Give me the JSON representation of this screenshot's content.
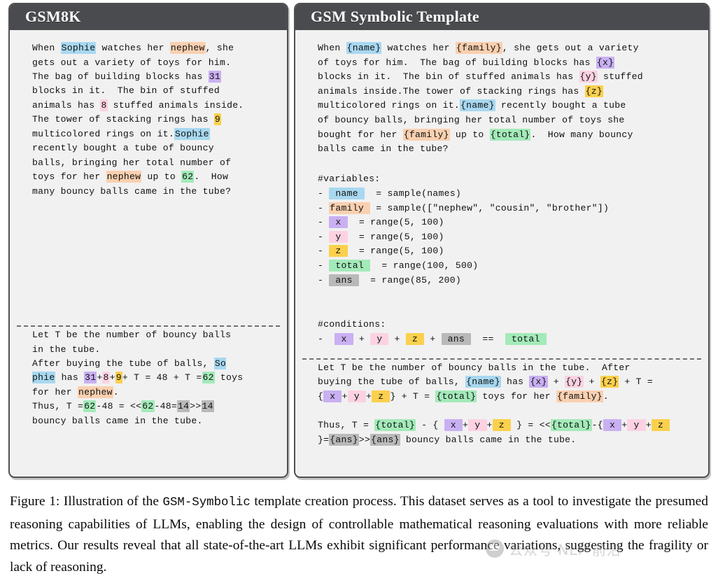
{
  "colors": {
    "page_bg": "#ffffff",
    "panel_bg": "#f1f1f1",
    "panel_border": "#4f5053",
    "header_bg": "#4a4b4e",
    "header_text": "#ffffff",
    "hl_blue": "#a8d8f0",
    "hl_peach": "#fad0b0",
    "hl_purple": "#c9b0f2",
    "hl_pink": "#fcd2e2",
    "hl_yellow": "#fbd04c",
    "hl_green": "#a3eab9",
    "hl_gray": "#b9b9b9"
  },
  "left_panel": {
    "title": "GSM8K",
    "problem_segments": [
      {
        "text": "When ",
        "hl": "none"
      },
      {
        "text": "Sophie",
        "hl": "blue"
      },
      {
        "text": " watches her ",
        "hl": "none"
      },
      {
        "text": "nephew",
        "hl": "peach"
      },
      {
        "text": ", she\ngets out a variety of toys for him.\nThe bag of building blocks has ",
        "hl": "none"
      },
      {
        "text": "31",
        "hl": "purple"
      },
      {
        "text": "\nblocks in it.  The bin of stuffed\nanimals has ",
        "hl": "none"
      },
      {
        "text": "8",
        "hl": "pink"
      },
      {
        "text": " stuffed animals inside.\nThe tower of stacking rings has ",
        "hl": "none"
      },
      {
        "text": "9",
        "hl": "yellow"
      },
      {
        "text": "\nmulticolored rings on it.",
        "hl": "none"
      },
      {
        "text": "Sophie",
        "hl": "blue"
      },
      {
        "text": "\nrecently bought a tube of bouncy\nballs, bringing her total number of\ntoys for her ",
        "hl": "none"
      },
      {
        "text": "nephew",
        "hl": "peach"
      },
      {
        "text": " up to ",
        "hl": "none"
      },
      {
        "text": "62",
        "hl": "green"
      },
      {
        "text": ".  How\nmany bouncy balls came in the tube?",
        "hl": "none"
      }
    ],
    "solution_segments": [
      {
        "text": "Let T be the number of bouncy balls\nin the tube.\nAfter buying the tube of balls, ",
        "hl": "none"
      },
      {
        "text": "So\nphie",
        "hl": "blue"
      },
      {
        "text": " has ",
        "hl": "none"
      },
      {
        "text": "31",
        "hl": "purple"
      },
      {
        "text": "+",
        "hl": "none"
      },
      {
        "text": "8",
        "hl": "pink"
      },
      {
        "text": "+",
        "hl": "none"
      },
      {
        "text": "9",
        "hl": "yellow"
      },
      {
        "text": "+ T = 48 + T =",
        "hl": "none"
      },
      {
        "text": "62",
        "hl": "green"
      },
      {
        "text": " toys\nfor her ",
        "hl": "none"
      },
      {
        "text": "nephew",
        "hl": "peach"
      },
      {
        "text": ".\nThus, T =",
        "hl": "none"
      },
      {
        "text": "62",
        "hl": "green"
      },
      {
        "text": "-48 = <<",
        "hl": "none"
      },
      {
        "text": "62",
        "hl": "green"
      },
      {
        "text": "-48=",
        "hl": "none"
      },
      {
        "text": "14",
        "hl": "gray"
      },
      {
        "text": ">>",
        "hl": "none"
      },
      {
        "text": "14",
        "hl": "gray"
      },
      {
        "text": "\nbouncy balls came in the tube.",
        "hl": "none"
      }
    ]
  },
  "right_panel": {
    "title": "GSM Symbolic Template",
    "template_segments": [
      {
        "text": "When ",
        "hl": "none"
      },
      {
        "text": "{name}",
        "hl": "blue"
      },
      {
        "text": " watches her ",
        "hl": "none"
      },
      {
        "text": "{family}",
        "hl": "peach"
      },
      {
        "text": ", she gets out a variety\nof toys for him.  The bag of building blocks has ",
        "hl": "none"
      },
      {
        "text": "{x}",
        "hl": "purple"
      },
      {
        "text": "\nblocks in it.  The bin of stuffed animals has ",
        "hl": "none"
      },
      {
        "text": "{y}",
        "hl": "pink"
      },
      {
        "text": " stuffed\nanimals inside.The tower of stacking rings has ",
        "hl": "none"
      },
      {
        "text": "{z}",
        "hl": "yellow"
      },
      {
        "text": "\nmulticolored rings on it.",
        "hl": "none"
      },
      {
        "text": "{name}",
        "hl": "blue"
      },
      {
        "text": " recently bought a tube\nof bouncy balls, bringing her total number of toys she\nbought for her ",
        "hl": "none"
      },
      {
        "text": "{family}",
        "hl": "peach"
      },
      {
        "text": " up to ",
        "hl": "none"
      },
      {
        "text": "{total}",
        "hl": "green"
      },
      {
        "text": ".  How many bouncy\nballs came in the tube?",
        "hl": "none"
      }
    ],
    "variables_header": "#variables:",
    "variables": [
      {
        "bullet": "-",
        "name": "name",
        "hl": "blue",
        "pad_before": " ",
        "pad_after": "  ",
        "expr": "= sample(names)"
      },
      {
        "bullet": "-",
        "name": "family",
        "hl": "peach",
        "pad_before": "",
        "pad_after": " ",
        "expr": "= sample([\"nephew\", \"cousin\", \"brother\"])"
      },
      {
        "bullet": "-",
        "name": "x",
        "hl": "purple",
        "pad_before": " ",
        "pad_after": "  ",
        "expr": "= range(5, 100)"
      },
      {
        "bullet": "-",
        "name": "y",
        "hl": "pink",
        "pad_before": " ",
        "pad_after": "  ",
        "expr": "= range(5, 100)"
      },
      {
        "bullet": "-",
        "name": "z",
        "hl": "yellow",
        "pad_before": " ",
        "pad_after": "  ",
        "expr": "= range(5, 100)"
      },
      {
        "bullet": "-",
        "name": "total",
        "hl": "green",
        "pad_before": " ",
        "pad_after": "  ",
        "expr": "= range(100, 500)"
      },
      {
        "bullet": "-",
        "name": "ans",
        "hl": "gray",
        "pad_before": " ",
        "pad_after": "  ",
        "expr": "= range(85, 200)"
      }
    ],
    "conditions_header": "#conditions:",
    "condition_segments": [
      {
        "text": "-  ",
        "hl": "none"
      },
      {
        "text": " x ",
        "hl": "purple"
      },
      {
        "text": " + ",
        "hl": "none"
      },
      {
        "text": " y ",
        "hl": "pink"
      },
      {
        "text": " + ",
        "hl": "none"
      },
      {
        "text": " z ",
        "hl": "yellow"
      },
      {
        "text": " + ",
        "hl": "none"
      },
      {
        "text": " ans ",
        "hl": "gray"
      },
      {
        "text": "  ==  ",
        "hl": "none"
      },
      {
        "text": " total ",
        "hl": "green"
      }
    ],
    "solution_segments": [
      {
        "text": "Let T be the number of bouncy balls in the tube.  After\nbuying the tube of balls, ",
        "hl": "none"
      },
      {
        "text": "{name}",
        "hl": "blue"
      },
      {
        "text": " has ",
        "hl": "none"
      },
      {
        "text": "{x}",
        "hl": "purple"
      },
      {
        "text": " + ",
        "hl": "none"
      },
      {
        "text": "{y}",
        "hl": "pink"
      },
      {
        "text": " + ",
        "hl": "none"
      },
      {
        "text": "{z}",
        "hl": "yellow"
      },
      {
        "text": " + T =\n{",
        "hl": "none"
      },
      {
        "text": " x ",
        "hl": "purple"
      },
      {
        "text": "+",
        "hl": "none"
      },
      {
        "text": " y ",
        "hl": "pink"
      },
      {
        "text": "+",
        "hl": "none"
      },
      {
        "text": " z ",
        "hl": "yellow"
      },
      {
        "text": "} + T = ",
        "hl": "none"
      },
      {
        "text": "{total}",
        "hl": "green"
      },
      {
        "text": " toys for her ",
        "hl": "none"
      },
      {
        "text": "{family}",
        "hl": "peach"
      },
      {
        "text": ".\n\nThus, T = ",
        "hl": "none"
      },
      {
        "text": "{total}",
        "hl": "green"
      },
      {
        "text": " - { ",
        "hl": "none"
      },
      {
        "text": " x ",
        "hl": "purple"
      },
      {
        "text": "+",
        "hl": "none"
      },
      {
        "text": " y ",
        "hl": "pink"
      },
      {
        "text": "+",
        "hl": "none"
      },
      {
        "text": " z ",
        "hl": "yellow"
      },
      {
        "text": " } = <<",
        "hl": "none"
      },
      {
        "text": "{total}",
        "hl": "green"
      },
      {
        "text": "-{",
        "hl": "none"
      },
      {
        "text": " x ",
        "hl": "purple"
      },
      {
        "text": "+",
        "hl": "none"
      },
      {
        "text": " y ",
        "hl": "pink"
      },
      {
        "text": "+",
        "hl": "none"
      },
      {
        "text": " z ",
        "hl": "yellow"
      },
      {
        "text": "\n}=",
        "hl": "none"
      },
      {
        "text": "{ans}",
        "hl": "gray"
      },
      {
        "text": ">>",
        "hl": "none"
      },
      {
        "text": "{ans}",
        "hl": "gray"
      },
      {
        "text": " bouncy balls came in the tube.",
        "hl": "none"
      }
    ]
  },
  "caption": {
    "part1": "Figure 1: Illustration of the ",
    "mono": "GSM-Symbolic",
    "part2": " template creation process.  This dataset serves as a tool to investigate the presumed reasoning capabilities of LLMs, enabling the design of controllable mathematical reasoning evaluations with more reliable metrics. Our results reveal that all state-of-the-art LLMs exhibit significant performance variations, suggesting the fragility or lack of reasoning."
  },
  "watermark": {
    "text": "公众号 NLP 前沿",
    "logo": "chat-bubble-icon"
  }
}
